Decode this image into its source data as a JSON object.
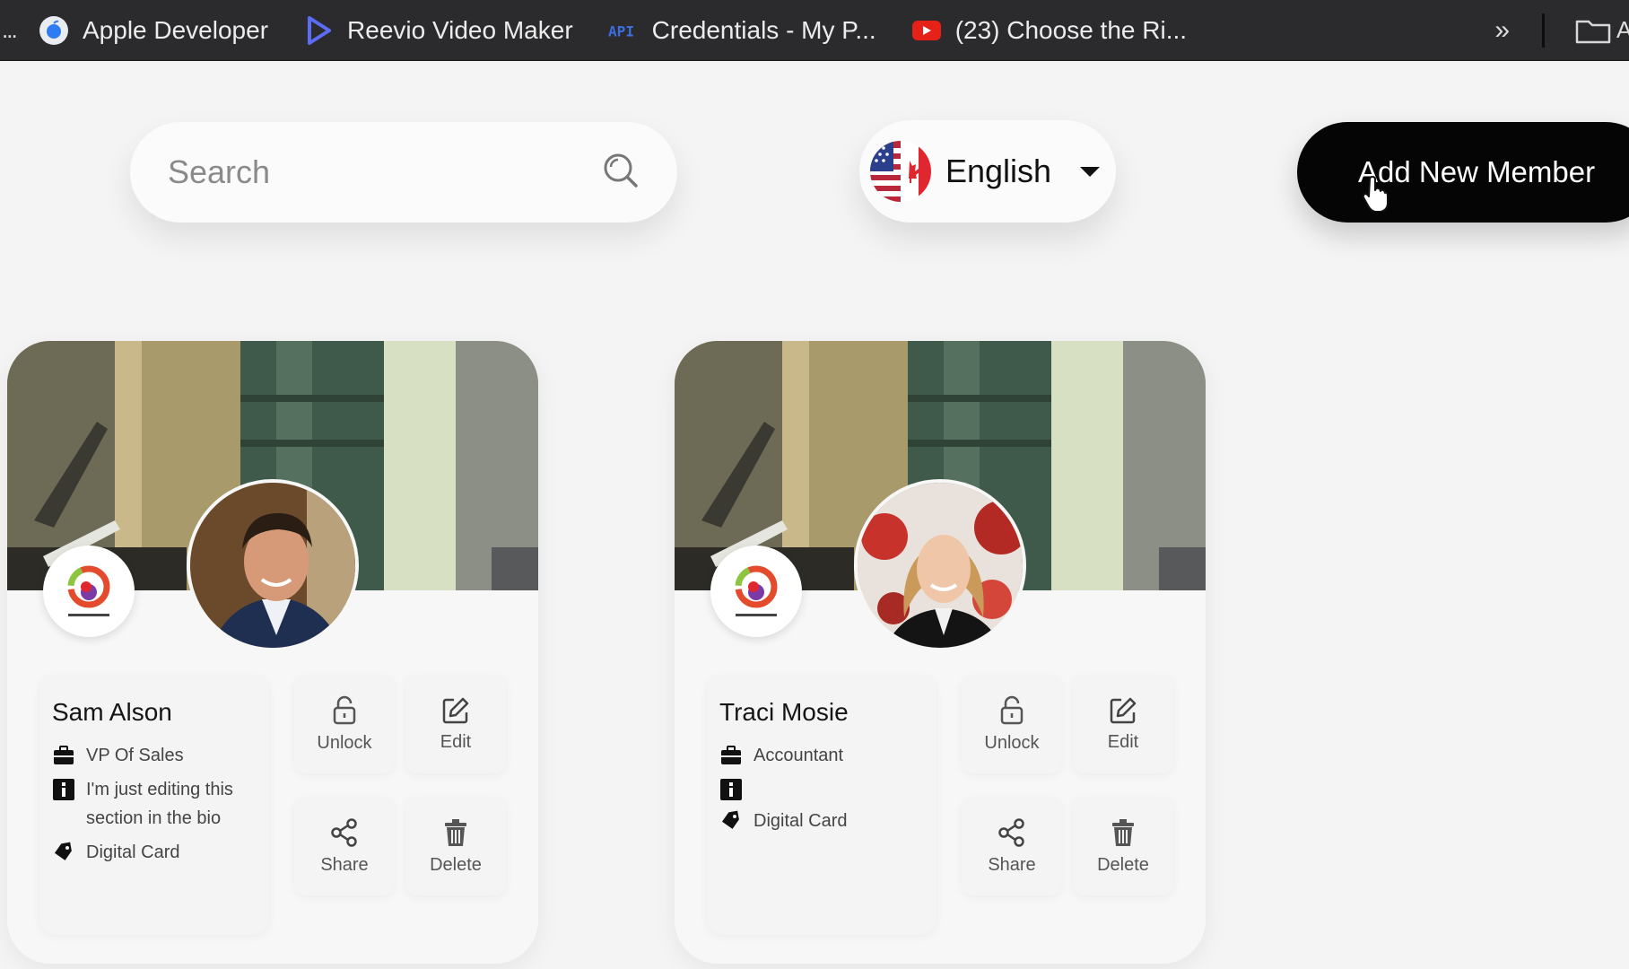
{
  "bookmarks": {
    "leading": "...",
    "items": [
      {
        "label": "Apple Developer",
        "icon": "apple-developer-icon"
      },
      {
        "label": "Reevio Video Maker",
        "icon": "reevio-play-icon"
      },
      {
        "label": "Credentials - My P...",
        "icon": "api-icon"
      },
      {
        "label": "(23) Choose the Ri...",
        "icon": "youtube-icon"
      }
    ],
    "overflow": "»",
    "folder_label": "A"
  },
  "toolbar": {
    "search_placeholder": "Search",
    "language": "English",
    "add_button": "Add New Member"
  },
  "members": [
    {
      "name": "Sam Alson",
      "title": "VP Of Sales",
      "bio": "I'm just editing this section in the bio",
      "card_type": "Digital Card"
    },
    {
      "name": "Traci Mosie",
      "title": "Accountant",
      "bio": "",
      "card_type": "Digital Card"
    }
  ],
  "actions": {
    "unlock": "Unlock",
    "edit": "Edit",
    "share": "Share",
    "delete": "Delete"
  },
  "colors": {
    "bookmark_bar": "#2b2b2d",
    "page_bg": "#f4f4f5",
    "primary_button": "#050505",
    "youtube_red": "#e62117",
    "api_blue": "#3b6fe0"
  }
}
